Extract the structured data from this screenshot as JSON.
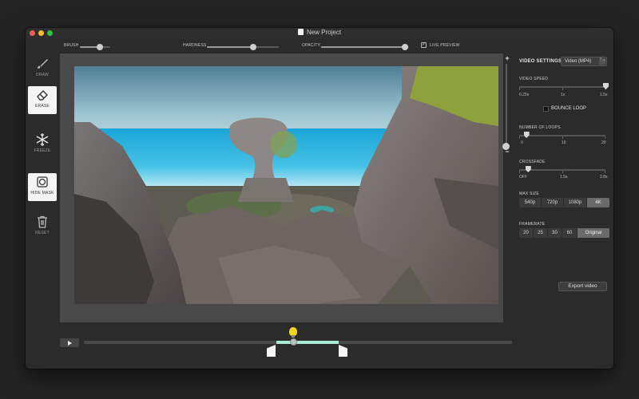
{
  "window": {
    "title": "New Project"
  },
  "toolbar": {
    "brush_label": "BRUSH",
    "brush_value": 0.65,
    "hardness_label": "HARDNESS",
    "hardness_value": 0.64,
    "opacity_label": "OPACITY",
    "opacity_value": 0.95,
    "live_preview_label": "LIVE PREVIEW",
    "live_preview_checked": true,
    "check_glyph": "✓"
  },
  "sidebar": {
    "tools": [
      {
        "label": "DRAW",
        "icon": "brush-icon",
        "active": false
      },
      {
        "label": "ERASE",
        "icon": "eraser-icon",
        "active": true
      },
      {
        "label": "FREEZE",
        "icon": "snowflake-icon",
        "active": false
      },
      {
        "label": "HIDE MASK",
        "icon": "mask-icon",
        "active": true
      },
      {
        "label": "RESET",
        "icon": "trash-icon",
        "active": false
      }
    ]
  },
  "canvas": {
    "zoom_plus": "+",
    "zoom_minus": "−",
    "zoom_value": 0.05
  },
  "panel": {
    "heading": "VIDEO SETTINGS",
    "format_value": "Video (MP4)",
    "format_chevron": "⌃⌄",
    "video_speed": {
      "label": "VIDEO SPEED",
      "ticks": [
        "0.25x",
        "1x",
        "1.5x"
      ],
      "value": 1.0
    },
    "bounce_loop": {
      "label": "BOUNCE LOOP",
      "checked": false
    },
    "number_of_loops": {
      "label": "NUMBER OF LOOPS",
      "ticks": [
        "0",
        "10",
        "20"
      ],
      "value": 0.08
    },
    "crossfade": {
      "label": "CROSSFADE",
      "ticks": [
        "OFF",
        "1.5s",
        "2.8s"
      ],
      "value": 0.1
    },
    "max_size": {
      "label": "MAX SIZE",
      "options": [
        "540p",
        "720p",
        "1080p",
        "4K"
      ],
      "selected": "4K"
    },
    "framerate": {
      "label": "FRAMERATE",
      "options": [
        "20",
        "25",
        "30",
        "60",
        "Original"
      ],
      "selected": "Original"
    },
    "export_label": "Export video"
  },
  "timeline": {
    "play_icon": "play-icon",
    "range_start": 0.45,
    "range_end": 0.6,
    "playhead": 0.49,
    "range_color": "#a8ebd4",
    "bulb_color": "#f5d51e"
  }
}
